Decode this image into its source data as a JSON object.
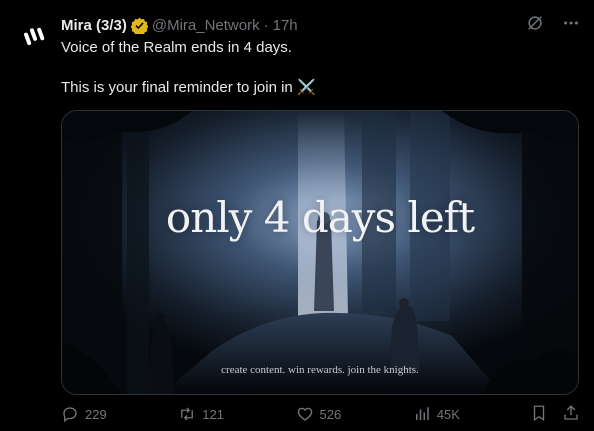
{
  "tweet": {
    "author_name": "Mira (3/3)",
    "handle": "@Mira_Network",
    "separator": "·",
    "time": "17h",
    "line1": "Voice of the Realm ends in 4 days.",
    "line2": "This is your final reminder to join in",
    "emoji": "⚔️",
    "verified_color": "#e2b719",
    "accent_color": "#1d9bf0"
  },
  "media": {
    "headline": "only 4 days left",
    "caption": "create content. win rewards. join the knights."
  },
  "actions": {
    "replies": "229",
    "retweets": "121",
    "likes": "526",
    "views": "45K"
  },
  "icons": [
    "mira-logo-icon",
    "verified-badge-icon",
    "grok-icon",
    "more-icon",
    "reply-icon",
    "retweet-icon",
    "like-icon",
    "views-icon",
    "bookmark-icon",
    "share-icon"
  ]
}
